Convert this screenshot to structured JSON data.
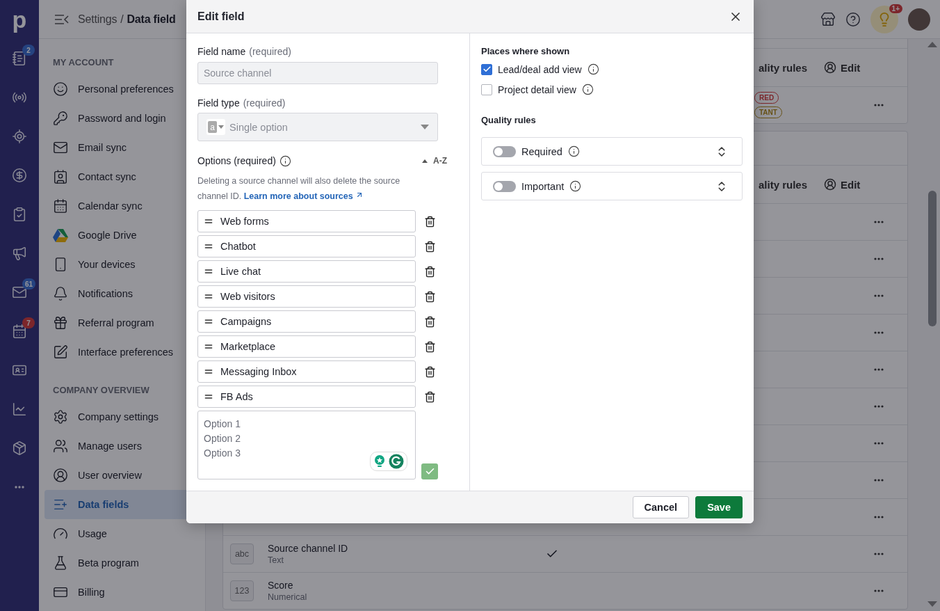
{
  "rail": {
    "logo": "p",
    "items": [
      {
        "kind": "list",
        "badge": {
          "text": "2",
          "kind": "info"
        }
      },
      {
        "kind": "broadcast"
      },
      {
        "kind": "target"
      },
      {
        "kind": "dollar"
      },
      {
        "kind": "clipboard"
      },
      {
        "kind": "megaphone"
      },
      {
        "kind": "mail",
        "badge": {
          "text": "61",
          "kind": "info"
        }
      },
      {
        "kind": "calendar",
        "badge": {
          "text": "7",
          "kind": "alert"
        }
      },
      {
        "kind": "card"
      },
      {
        "kind": "chart"
      },
      {
        "kind": "box"
      },
      {
        "kind": "more"
      }
    ]
  },
  "header": {
    "breadcrumb": [
      "Settings",
      "Data field"
    ],
    "separator": "/",
    "notification_badge": "1+"
  },
  "sidebar": {
    "sections": [
      {
        "title": "MY ACCOUNT",
        "items": [
          {
            "label": "Personal preferences",
            "kind": "face",
            "selected": false
          },
          {
            "label": "Password and login",
            "kind": "key",
            "selected": false
          },
          {
            "label": "Email sync",
            "kind": "mail",
            "selected": false
          },
          {
            "label": "Contact sync",
            "kind": "contact",
            "selected": false
          },
          {
            "label": "Calendar sync",
            "kind": "calendar",
            "selected": false
          },
          {
            "label": "Google Drive",
            "kind": "drive",
            "selected": false
          },
          {
            "label": "Your devices",
            "kind": "phone",
            "selected": false
          },
          {
            "label": "Notifications",
            "kind": "bell",
            "selected": false
          },
          {
            "label": "Referral program",
            "kind": "gift",
            "selected": false
          },
          {
            "label": "Interface preferences",
            "kind": "pen",
            "selected": false
          }
        ]
      },
      {
        "title": "COMPANY OVERVIEW",
        "items": [
          {
            "label": "Company settings",
            "kind": "gear",
            "selected": false
          },
          {
            "label": "Manage users",
            "kind": "users",
            "selected": false
          },
          {
            "label": "User overview",
            "kind": "user",
            "selected": false
          },
          {
            "label": "Data fields",
            "kind": "fields",
            "selected": true
          },
          {
            "label": "Usage",
            "kind": "gauge",
            "selected": false
          },
          {
            "label": "Beta program",
            "kind": "flask",
            "selected": false
          },
          {
            "label": "Billing",
            "kind": "billing",
            "selected": false
          }
        ]
      }
    ]
  },
  "table": {
    "cards": [
      {
        "header": {
          "quality": "ality rules",
          "edit": "Edit"
        },
        "rows": [
          {
            "check": false,
            "tags": [
              {
                "text": "RED",
                "kind": "required"
              },
              {
                "text": "TANT",
                "kind": "important"
              }
            ]
          }
        ]
      },
      {
        "header": {
          "quality": "ality rules",
          "edit": "Edit"
        },
        "rows": [
          {
            "check": false
          },
          {
            "check": false
          },
          {
            "check": false
          },
          {
            "check": false
          },
          {
            "check": false
          },
          {
            "check": false
          },
          {
            "check": false
          },
          {
            "check": false
          },
          {
            "check": false
          },
          {
            "type_icon": "abc",
            "name": "Source channel ID",
            "type": "Text",
            "check": true
          },
          {
            "type_icon": "123",
            "name": "Score",
            "type": "Numerical",
            "check": false
          }
        ]
      }
    ]
  },
  "modal": {
    "title": "Edit field",
    "field_name": {
      "label": "Field name",
      "hint": "(required)",
      "value": "Source channel",
      "disabled": true
    },
    "field_type": {
      "label": "Field type",
      "hint": "(required)",
      "icon_letter": "a",
      "value": "Single option",
      "disabled": true
    },
    "options": {
      "label": "Options (required)",
      "sort": "A-Z",
      "help": "Deleting a source channel will also delete the source channel ID.",
      "link": "Learn more about sources",
      "items": [
        "Web forms",
        "Chatbot",
        "Live chat",
        "Web visitors",
        "Campaigns",
        "Marketplace",
        "Messaging Inbox",
        "FB Ads"
      ],
      "new_placeholder": "Option 1\nOption 2\nOption 3"
    },
    "places": {
      "title": "Places where shown",
      "items": [
        {
          "label": "Lead/deal add view",
          "checked": true
        },
        {
          "label": "Project detail view",
          "checked": false
        }
      ]
    },
    "quality": {
      "title": "Quality rules",
      "rules": [
        {
          "label": "Required",
          "on": false
        },
        {
          "label": "Important",
          "on": false
        }
      ]
    },
    "buttons": {
      "cancel": "Cancel",
      "save": "Save"
    }
  }
}
